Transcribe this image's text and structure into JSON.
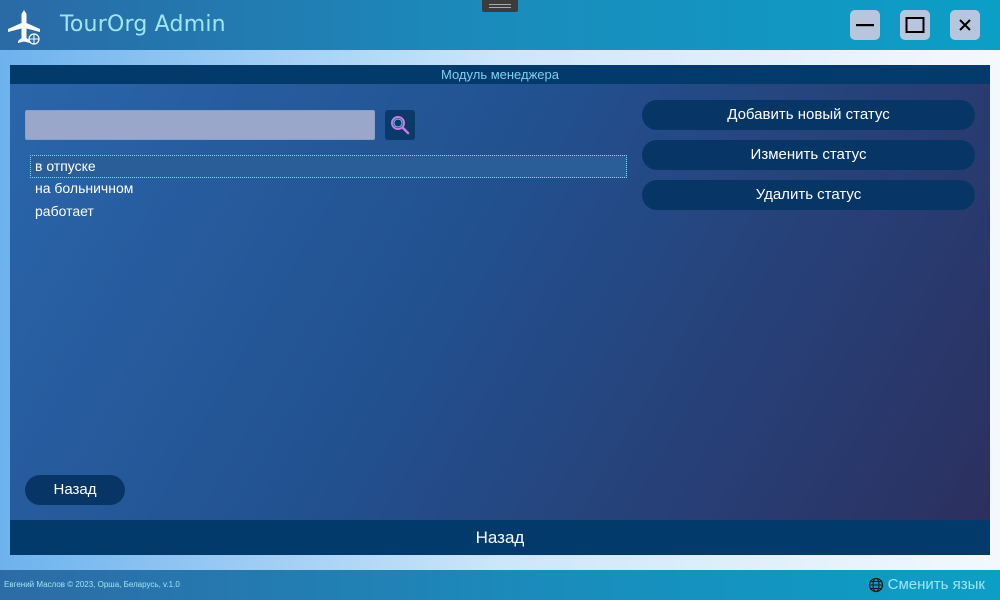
{
  "window": {
    "title": "TourOrg Admin",
    "controls": {
      "minimize_icon": "minimize-icon",
      "maximize_icon": "maximize-icon",
      "close_icon": "close-icon"
    }
  },
  "module": {
    "header": "Модуль менеджера"
  },
  "search": {
    "value": "",
    "placeholder": "",
    "icon": "search-icon"
  },
  "statuses": {
    "items": [
      {
        "label": "в отпуске",
        "selected": true
      },
      {
        "label": "на больничном",
        "selected": false
      },
      {
        "label": "работает",
        "selected": false
      }
    ]
  },
  "actions": {
    "add_label": "Добавить новый статус",
    "edit_label": "Изменить статус",
    "delete_label": "Удалить статус",
    "back_label": "Назад"
  },
  "bottom_bar": {
    "back_label": "Назад"
  },
  "footer": {
    "copyright": "Евгений Маслов © 2023, Орша, Беларусь, v.1.0",
    "language_label": "Сменить язык",
    "language_icon": "globe-icon"
  },
  "colors": {
    "accent_text": "#9fe6f4",
    "button_bg": "#073566",
    "header_bg": "#033a6c"
  }
}
